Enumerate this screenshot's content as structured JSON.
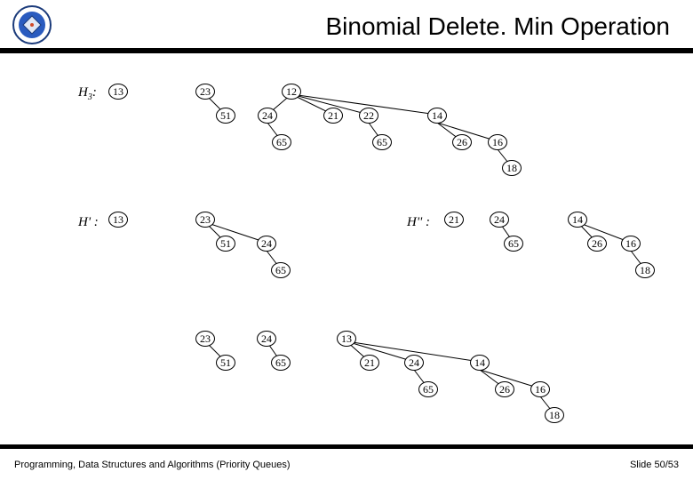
{
  "title": "Binomial Delete. Min Operation",
  "footer_left": "Programming, Data Structures and Algorithms (Priority Queues)",
  "footer_right": "Slide 50/53",
  "labels": {
    "h3": "H",
    "h3_sub": "3",
    "h3_colon": ":",
    "hp": "H' :",
    "hpp": "H'' :"
  },
  "chart_data": {
    "type": "tree-forest",
    "description": "Three stages of binomial-heap DeleteMin. H3 is the initial heap; H' keeps the non-min trees, H'' is the reversed children of the deleted min (12); the last row is the merged result.",
    "stage1_H3": [
      {
        "root": 13
      },
      {
        "root": 23,
        "children": [
          {
            "v": 51
          }
        ]
      },
      {
        "root": 12,
        "children": [
          {
            "v": 24,
            "children": [
              {
                "v": 65
              }
            ]
          },
          {
            "v": 21
          },
          {
            "v": 22,
            "children": [
              {
                "v": 65
              }
            ]
          },
          {
            "v": 14,
            "children": [
              {
                "v": 26
              },
              {
                "v": 16,
                "children": [
                  {
                    "v": 18
                  }
                ]
              }
            ]
          }
        ]
      }
    ],
    "stage2_Hprime": [
      {
        "root": 13
      },
      {
        "root": 23,
        "children": [
          {
            "v": 51
          },
          {
            "v": 24,
            "children": [
              {
                "v": 65
              }
            ]
          }
        ]
      }
    ],
    "stage2_Hdoubleprime": [
      {
        "root": 21
      },
      {
        "root": 24,
        "children": [
          {
            "v": 65
          }
        ]
      },
      {
        "root": 14,
        "children": [
          {
            "v": 26
          },
          {
            "v": 16,
            "children": [
              {
                "v": 18
              }
            ]
          }
        ]
      }
    ],
    "stage3_merged": [
      {
        "root": 23,
        "children": [
          {
            "v": 51
          }
        ]
      },
      {
        "root": 24,
        "children": [
          {
            "v": 65
          }
        ]
      },
      {
        "root": 13,
        "children": [
          {
            "v": 21
          },
          {
            "v": 24,
            "children": [
              {
                "v": 65
              }
            ]
          },
          {
            "v": 14,
            "children": [
              {
                "v": 26
              },
              {
                "v": 16,
                "children": [
                  {
                    "v": 18
                  }
                ]
              }
            ]
          }
        ]
      }
    ]
  },
  "nodes": {
    "a13": "13",
    "a23": "23",
    "a51": "51",
    "a12": "12",
    "a24": "24",
    "a65": "65",
    "a21": "21",
    "a22": "22",
    "a65b": "65",
    "a14": "14",
    "a26": "26",
    "a16": "16",
    "a18": "18",
    "b13": "13",
    "b23": "23",
    "b51": "51",
    "b24": "24",
    "b65": "65",
    "c21": "21",
    "c24": "24",
    "c65": "65",
    "c14": "14",
    "c26": "26",
    "c16": "16",
    "c18": "18",
    "d23": "23",
    "d51": "51",
    "d24": "24",
    "d65": "65",
    "d13": "13",
    "d21": "21",
    "d24b": "24",
    "d65b": "65",
    "d14": "14",
    "d26": "26",
    "d16": "16",
    "d18": "18"
  }
}
